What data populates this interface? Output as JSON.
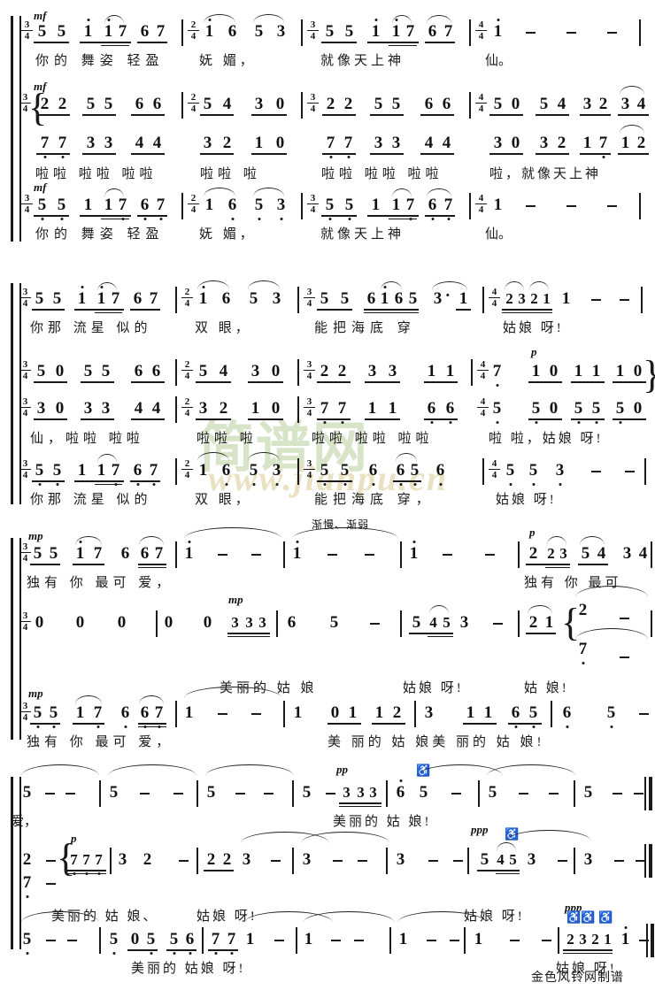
{
  "document": {
    "type": "jianpu-choral-score",
    "credit": "金色风铃网制谱",
    "watermark": {
      "logo_text": "简谱网",
      "url_text": "www.jianpu.cn"
    },
    "tempo_annotations": [
      {
        "text": "渐慢、渐弱"
      }
    ]
  },
  "systems": [
    {
      "id": "system-1",
      "voices": [
        {
          "id": "s1-v1",
          "dynamic": "mf",
          "measures": [
            {
              "time": "3/4",
              "notes": "5 5  1 17 67",
              "lyrics": "你的 舞姿 轻盈"
            },
            {
              "time": "2/4",
              "notes": "1 6  5 3",
              "lyrics": "妩  媚，"
            },
            {
              "time": "3/4",
              "notes": "5 5  1 17 67",
              "lyrics": "就像天上神"
            },
            {
              "time": "4/4",
              "notes": "1 - - -",
              "lyrics": "仙。"
            }
          ]
        },
        {
          "id": "s1-v2",
          "dynamic": "mf",
          "measures": [
            {
              "time": "3/4",
              "notes": "22 55 66",
              "lyrics": "啦啦 啦啦 啦啦"
            },
            {
              "time": "2/4",
              "notes": "5 4 3 0",
              "lyrics": "啦啦 啦"
            },
            {
              "time": "3/4",
              "notes": "22 55 66",
              "lyrics": "啦啦 啦啦 啦啦"
            },
            {
              "time": "4/4",
              "notes": "50 54 32 34",
              "lyrics": "啦，就像天上神"
            }
          ]
        },
        {
          "id": "s1-v3",
          "dynamic": "",
          "measures": [
            {
              "time": "3/4",
              "notes": "77 33 44",
              "lyrics": ""
            },
            {
              "time": "2/4",
              "notes": "3 2 1 0",
              "lyrics": ""
            },
            {
              "time": "3/4",
              "notes": "77 33 44",
              "lyrics": ""
            },
            {
              "time": "4/4",
              "notes": "30 32 17 12",
              "lyrics": ""
            }
          ]
        },
        {
          "id": "s1-v4",
          "dynamic": "mf",
          "measures": [
            {
              "time": "3/4",
              "notes": "5 5  1 17 67",
              "lyrics": "你的 舞姿 轻盈"
            },
            {
              "time": "2/4",
              "notes": "1 6  5 3",
              "lyrics": "妩  媚，"
            },
            {
              "time": "3/4",
              "notes": "5 5  1 17 67",
              "lyrics": "就像天上神"
            },
            {
              "time": "4/4",
              "notes": "1 - - -",
              "lyrics": "仙。"
            }
          ]
        }
      ]
    },
    {
      "id": "system-2",
      "voices": [
        {
          "id": "s2-v1",
          "dynamic": "",
          "measures": [
            {
              "time": "3/4",
              "notes": "5 5  1 17 67",
              "lyrics": "你那 流星 似的"
            },
            {
              "time": "2/4",
              "notes": "1 6  5 3",
              "lyrics": "双  眼，"
            },
            {
              "time": "3/4",
              "notes": "5 5 6165 3. 1",
              "lyrics": "能把海底 穿"
            },
            {
              "time": "4/4",
              "notes": "2321 1 - -",
              "lyrics": "姑娘 呀!"
            }
          ]
        },
        {
          "id": "s2-v2",
          "dynamic": "p",
          "measures": [
            {
              "time": "3/4",
              "notes": "50 55 66",
              "lyrics": "仙， 啦啦 啦啦"
            },
            {
              "time": "2/4",
              "notes": "5 4 3 0",
              "lyrics": "啦啦 啦"
            },
            {
              "time": "3/4",
              "notes": "22 33 11",
              "lyrics": "啦啦 啦啦 啦啦"
            },
            {
              "time": "4/4",
              "notes": "7  10 11 10",
              "lyrics": "啦  啦，姑娘 呀!"
            }
          ]
        },
        {
          "id": "s2-v3",
          "dynamic": "",
          "measures": [
            {
              "time": "3/4",
              "notes": "30 33 44",
              "lyrics": ""
            },
            {
              "time": "2/4",
              "notes": "3 2 1 0",
              "lyrics": ""
            },
            {
              "time": "3/4",
              "notes": "77 11 66",
              "lyrics": ""
            },
            {
              "time": "4/4",
              "notes": "5  50 55 50",
              "lyrics": ""
            }
          ]
        },
        {
          "id": "s2-v4",
          "dynamic": "",
          "measures": [
            {
              "time": "3/4",
              "notes": "5 5  1 17 67",
              "lyrics": "你那 流星 似的"
            },
            {
              "time": "2/4",
              "notes": "1 6  5 3",
              "lyrics": "双  眼，"
            },
            {
              "time": "3/4",
              "notes": "5 5 6 65 6",
              "lyrics": "能把海底 穿，"
            },
            {
              "time": "4/4",
              "notes": "5 5 3 - -",
              "lyrics": "姑娘 呀!"
            }
          ]
        }
      ]
    },
    {
      "id": "system-3",
      "voices": [
        {
          "id": "s3-v1",
          "dynamic": "mp",
          "measures": [
            {
              "time": "3/4",
              "notes": "55 17 6 67",
              "lyrics": "独有 你 最可 爱，"
            },
            {
              "time": "",
              "notes": "1 - -",
              "lyrics": ""
            },
            {
              "time": "",
              "notes": "1 - -",
              "lyrics": ""
            },
            {
              "time": "",
              "notes": "1 - -",
              "lyrics": ""
            },
            {
              "time": "",
              "notes": "2 23 54 34",
              "dynamic": "p",
              "lyrics": "独有 你  最可"
            }
          ]
        },
        {
          "id": "s3-v2",
          "dynamic": "",
          "measures": [
            {
              "time": "3/4",
              "notes": "0 0 0",
              "lyrics": ""
            },
            {
              "time": "",
              "notes": "0 0 333",
              "dynamic": "mp",
              "lyrics": "美丽的 姑 娘"
            },
            {
              "time": "",
              "notes": "6 5 -",
              "lyrics": ""
            },
            {
              "time": "",
              "notes": "545 3 -",
              "lyrics": "姑娘 呀!"
            },
            {
              "time": "",
              "notes": "21 {2 / 7} -",
              "lyrics": "姑  娘!"
            }
          ]
        },
        {
          "id": "s3-v3",
          "dynamic": "mp",
          "measures": [
            {
              "time": "3/4",
              "notes": "55 17 6 67",
              "lyrics": "独有 你 最可 爱，"
            },
            {
              "time": "",
              "notes": "1 - -",
              "lyrics": ""
            },
            {
              "time": "",
              "notes": "1  01 12",
              "lyrics": "美 丽的 姑"
            },
            {
              "time": "",
              "notes": "3  11 65",
              "lyrics": "娘美 丽的"
            },
            {
              "time": "",
              "notes": "6  5 -",
              "lyrics": "姑  娘!"
            }
          ]
        }
      ]
    },
    {
      "id": "system-4",
      "voices": [
        {
          "id": "s4-v1",
          "dynamic": "",
          "measures": [
            {
              "notes": "5 - -",
              "lyrics": "爱，"
            },
            {
              "notes": "5 - -",
              "lyrics": ""
            },
            {
              "notes": "5 - -",
              "lyrics": ""
            },
            {
              "notes": "5 - 333",
              "dynamic": "pp",
              "lyrics": "美丽的 姑 娘!"
            },
            {
              "notes": "6 5 -",
              "lyrics": ""
            },
            {
              "notes": "5 - -",
              "lyrics": ""
            },
            {
              "notes": "5 - -",
              "lyrics": ""
            }
          ]
        },
        {
          "id": "s4-v2",
          "dynamic": "p",
          "measures": [
            {
              "notes": "2 -  / 7 -",
              "lyrics": ""
            },
            {
              "notes": "777 3 2 -",
              "lyrics": "美丽的 姑 娘、"
            },
            {
              "notes": "223 -",
              "lyrics": "姑娘 呀!"
            },
            {
              "notes": "3 - -",
              "lyrics": ""
            },
            {
              "notes": "3 - -",
              "lyrics": ""
            },
            {
              "notes": "545 3 -",
              "dynamic": "ppp",
              "lyrics": "姑娘 呀!"
            },
            {
              "notes": "3 - -",
              "lyrics": ""
            }
          ]
        },
        {
          "id": "s4-v3",
          "dynamic": "",
          "measures": [
            {
              "notes": "5 - -",
              "lyrics": ""
            },
            {
              "notes": "5 05 56",
              "lyrics": "美丽的 姑娘 呀!"
            },
            {
              "notes": "771 -",
              "lyrics": ""
            },
            {
              "notes": "1 - -",
              "lyrics": ""
            },
            {
              "notes": "1 - -",
              "lyrics": ""
            },
            {
              "notes": "1 - -",
              "lyrics": ""
            },
            {
              "notes": "2321 1 -",
              "dynamic": "ppp",
              "lyrics": "姑娘 呀!"
            }
          ]
        }
      ]
    }
  ],
  "lyrics": {
    "s1_l1": "你的 舞姿 轻盈",
    "s1_l1b": "妩    媚，",
    "s1_l1c": "就像天上神",
    "s1_l1d": "仙。",
    "s1_l2": "啦啦 啦啦 啦啦",
    "s1_l2b": "啦啦 啦",
    "s1_l2c": "啦啦 啦啦 啦啦",
    "s1_l2d": "啦，就像天上神",
    "s1_l3": "你的 舞姿 轻盈",
    "s1_l3b": "妩   媚，",
    "s1_l3c": "就像天上神",
    "s1_l3d": "仙。",
    "s2_l1": "你那 流星 似的",
    "s2_l1b": "双    眼，",
    "s2_l1c": "能把海底 穿",
    "s2_l1d": "姑娘 呀!",
    "s2_l2": "仙，啦啦 啦啦",
    "s2_l2b": "啦啦 啦",
    "s2_l2c": "啦啦 啦啦 啦啦",
    "s2_l2d": "啦  啦，姑娘 呀!",
    "s2_l3": "你那 流星 似的",
    "s2_l3b": "双    眼，",
    "s2_l3c": "能把海底 穿，",
    "s2_l3d": "姑娘 呀!",
    "s3_l1": "独有 你 最可 爱，",
    "s3_l1b": "独有 你  最可",
    "s3_l2": "美丽的 姑  娘",
    "s3_l2b": "姑娘 呀!",
    "s3_l2c": "姑   娘!",
    "s3_l3": "独有 你 最可 爱，",
    "s3_l3b": "美 丽的 姑   娘美 丽的 姑   娘!",
    "s4_l1": "爱，",
    "s4_l1b": "美丽的 姑 娘!",
    "s4_l2": "美丽的 姑 娘、",
    "s4_l2b": "姑娘 呀!",
    "s4_l2c": "姑娘 呀!",
    "s4_l3": "美丽的 姑娘 呀!",
    "s4_l3b": "姑娘 呀!"
  }
}
